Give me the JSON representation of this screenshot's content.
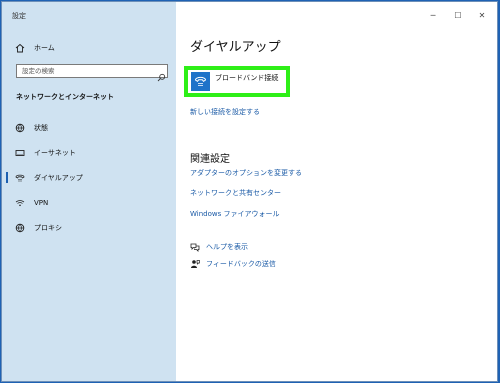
{
  "window": {
    "title": "設定",
    "minimize_glyph": "─",
    "maximize_glyph": "☐",
    "close_glyph": "✕"
  },
  "sidebar": {
    "home_label": "ホーム",
    "search_placeholder": "設定の検索",
    "section_title": "ネットワークとインターネット",
    "items": [
      {
        "label": "状態",
        "icon": "globe-icon"
      },
      {
        "label": "イーサネット",
        "icon": "ethernet-icon"
      },
      {
        "label": "ダイヤルアップ",
        "icon": "dialup-icon"
      },
      {
        "label": "VPN",
        "icon": "vpn-icon"
      },
      {
        "label": "プロキシ",
        "icon": "globe-icon"
      }
    ],
    "selected_index": 2
  },
  "main": {
    "title": "ダイヤルアップ",
    "connection_label": "ブロードバンド接続",
    "new_connection_link": "新しい接続を設定する",
    "related_title": "関連設定",
    "related_links": [
      "アダプターのオプションを変更する",
      "ネットワークと共有センター",
      "Windows ファイアウォール"
    ],
    "help_label": "ヘルプを表示",
    "feedback_label": "フィードバックの送信"
  },
  "colors": {
    "sidebar_bg": "#cfe2f1",
    "accent": "#1e73c9",
    "highlight": "#2eef17",
    "link": "#1a5aa6"
  }
}
